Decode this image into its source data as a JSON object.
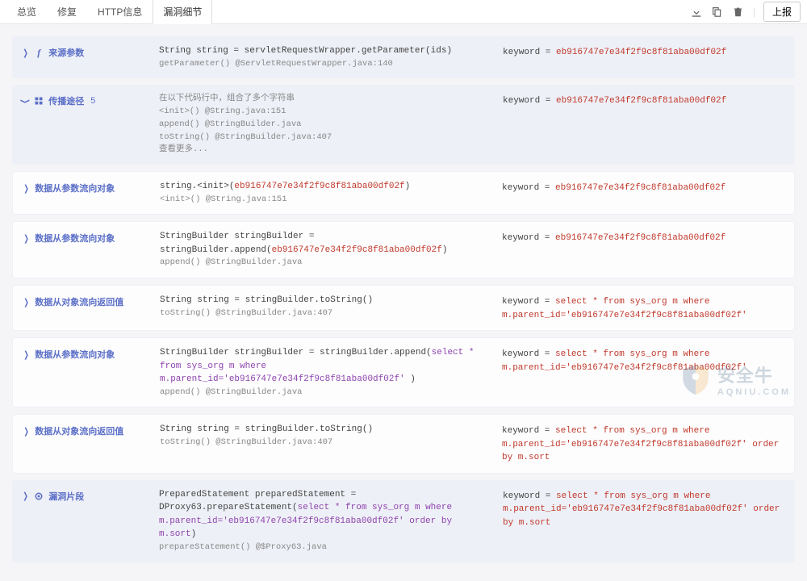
{
  "tabs": {
    "overview": "总览",
    "repair": "修复",
    "http": "HTTP信息",
    "vuln": "漏洞细节"
  },
  "topbar": {
    "report": "上报"
  },
  "hash": "eb916747e7e34f2f9c8f81aba00df02f",
  "rows": {
    "r0": {
      "title": "来源参数",
      "line1a": "String string = servletRequestWrapper.getParameter(ids)",
      "line2": "getParameter() @ServletRequestWrapper.java:140",
      "kw": "keyword = ",
      "val": "eb916747e7e34f2f9c8f81aba00df02f"
    },
    "r1": {
      "title": "传播途径",
      "count": "5",
      "line1": "在以下代码行中，组合了多个字符串",
      "line2": "<init>() @String.java:151",
      "line3": "append() @StringBuilder.java",
      "line4": "toString() @StringBuilder.java:407",
      "line5": "查看更多...",
      "kw": "keyword = ",
      "val": "eb916747e7e34f2f9c8f81aba00df02f"
    },
    "r2": {
      "title": "数据从参数流向对象",
      "pre": "string.<init>(",
      "hl": "eb916747e7e34f2f9c8f81aba00df02f",
      "post": ")",
      "sub": "<init>() @String.java:151",
      "kw": "keyword = ",
      "val": "eb916747e7e34f2f9c8f81aba00df02f"
    },
    "r3": {
      "title": "数据从参数流向对象",
      "pre": "StringBuilder stringBuilder = stringBuilder.append(",
      "hl": "eb916747e7e34f2f9c8f81aba00df02f",
      "post": ")",
      "sub": "append() @StringBuilder.java",
      "kw": "keyword = ",
      "val": "eb916747e7e34f2f9c8f81aba00df02f"
    },
    "r4": {
      "title": "数据从对象流向返回值",
      "line1": "String string = stringBuilder.toString()",
      "sub": "toString() @StringBuilder.java:407",
      "kw": "keyword = ",
      "val": "select * from sys_org m where m.parent_id='eb916747e7e34f2f9c8f81aba00df02f'"
    },
    "r5": {
      "title": "数据从参数流向对象",
      "pre": "StringBuilder stringBuilder = stringBuilder.append(",
      "hl": "select * from sys_org m where m.parent_id='eb916747e7e34f2f9c8f81aba00df02f' ",
      "post": ")",
      "sub": "append() @StringBuilder.java",
      "kw": "keyword = ",
      "val": "select * from sys_org m where m.parent_id='eb916747e7e34f2f9c8f81aba00df02f'"
    },
    "r6": {
      "title": "数据从对象流向返回值",
      "line1": "String string = stringBuilder.toString()",
      "sub": "toString() @StringBuilder.java:407",
      "kw": "keyword = ",
      "val": "select * from sys_org m where m.parent_id='eb916747e7e34f2f9c8f81aba00df02f' order by m.sort"
    },
    "r7": {
      "title": "漏洞片段",
      "pre": "PreparedStatement preparedStatement = DProxy63.prepareStatement(",
      "hl": "select * from sys_org m where m.parent_id='eb916747e7e34f2f9c8f81aba00df02f' order by m.sort",
      "post": ")",
      "sub": "prepareStatement() @$Proxy63.java",
      "kw": "keyword = ",
      "val": "select * from sys_org m where m.parent_id='eb916747e7e34f2f9c8f81aba00df02f' order by m.sort"
    }
  },
  "watermark": {
    "cn": "安全牛",
    "en": "AQNIU.COM"
  }
}
